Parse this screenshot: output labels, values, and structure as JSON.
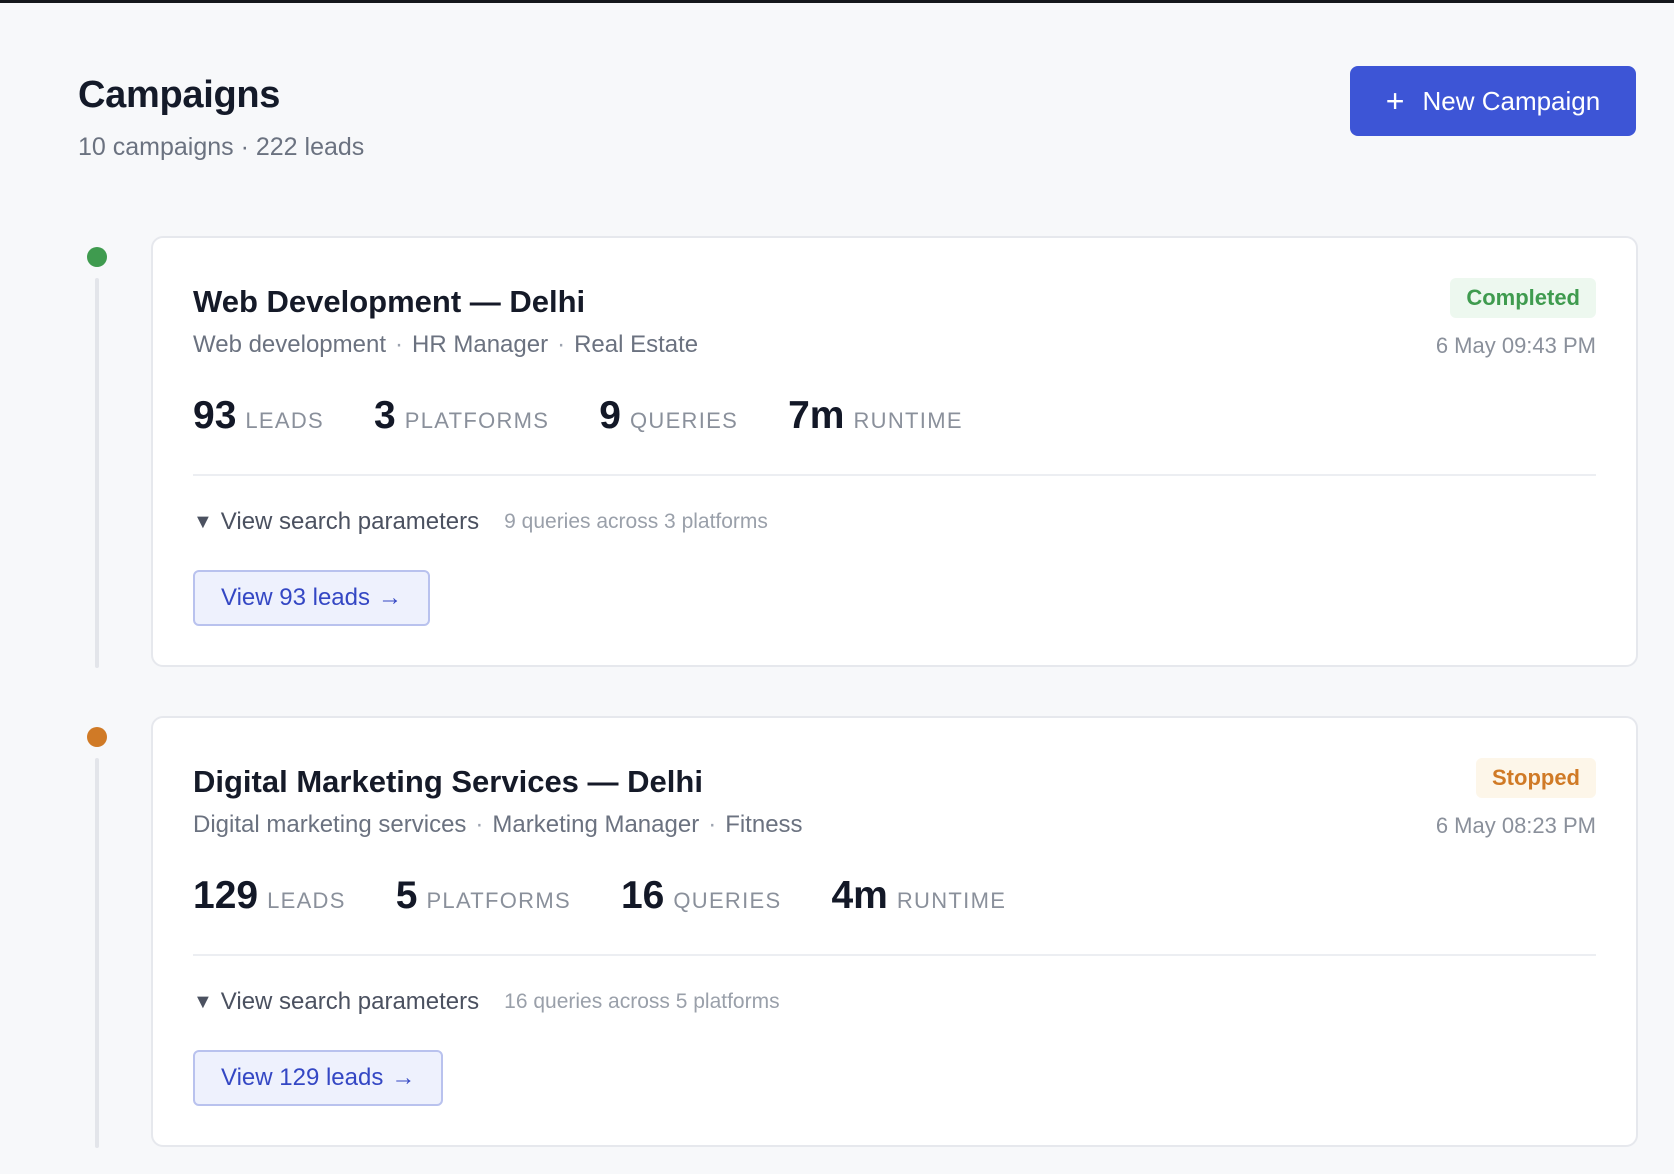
{
  "header": {
    "title": "Campaigns",
    "summary": "10 campaigns · 222 leads",
    "new_button_label": "New Campaign",
    "new_button_icon": "plus-icon"
  },
  "colors": {
    "accent": "#3d55d6",
    "completed": "#3f9b4f",
    "stopped": "#d07a26"
  },
  "campaigns": [
    {
      "title": "Web Development — Delhi",
      "service": "Web development",
      "role": "HR Manager",
      "industry": "Real Estate",
      "status": "Completed",
      "timestamp": "6 May 09:43 PM",
      "stats": {
        "leads": "93",
        "leads_label": "LEADS",
        "platforms": "3",
        "platforms_label": "PLATFORMS",
        "queries": "9",
        "queries_label": "QUERIES",
        "runtime": "7m",
        "runtime_label": "RUNTIME"
      },
      "params_toggle": "View search parameters",
      "params_summary": "9 queries across 3 platforms",
      "view_button": "View 93 leads"
    },
    {
      "title": "Digital Marketing Services — Delhi",
      "service": "Digital marketing services",
      "role": "Marketing Manager",
      "industry": "Fitness",
      "status": "Stopped",
      "timestamp": "6 May 08:23 PM",
      "stats": {
        "leads": "129",
        "leads_label": "LEADS",
        "platforms": "5",
        "platforms_label": "PLATFORMS",
        "queries": "16",
        "queries_label": "QUERIES",
        "runtime": "4m",
        "runtime_label": "RUNTIME"
      },
      "params_toggle": "View search parameters",
      "params_summary": "16 queries across 5 platforms",
      "view_button": "View 129 leads"
    }
  ]
}
